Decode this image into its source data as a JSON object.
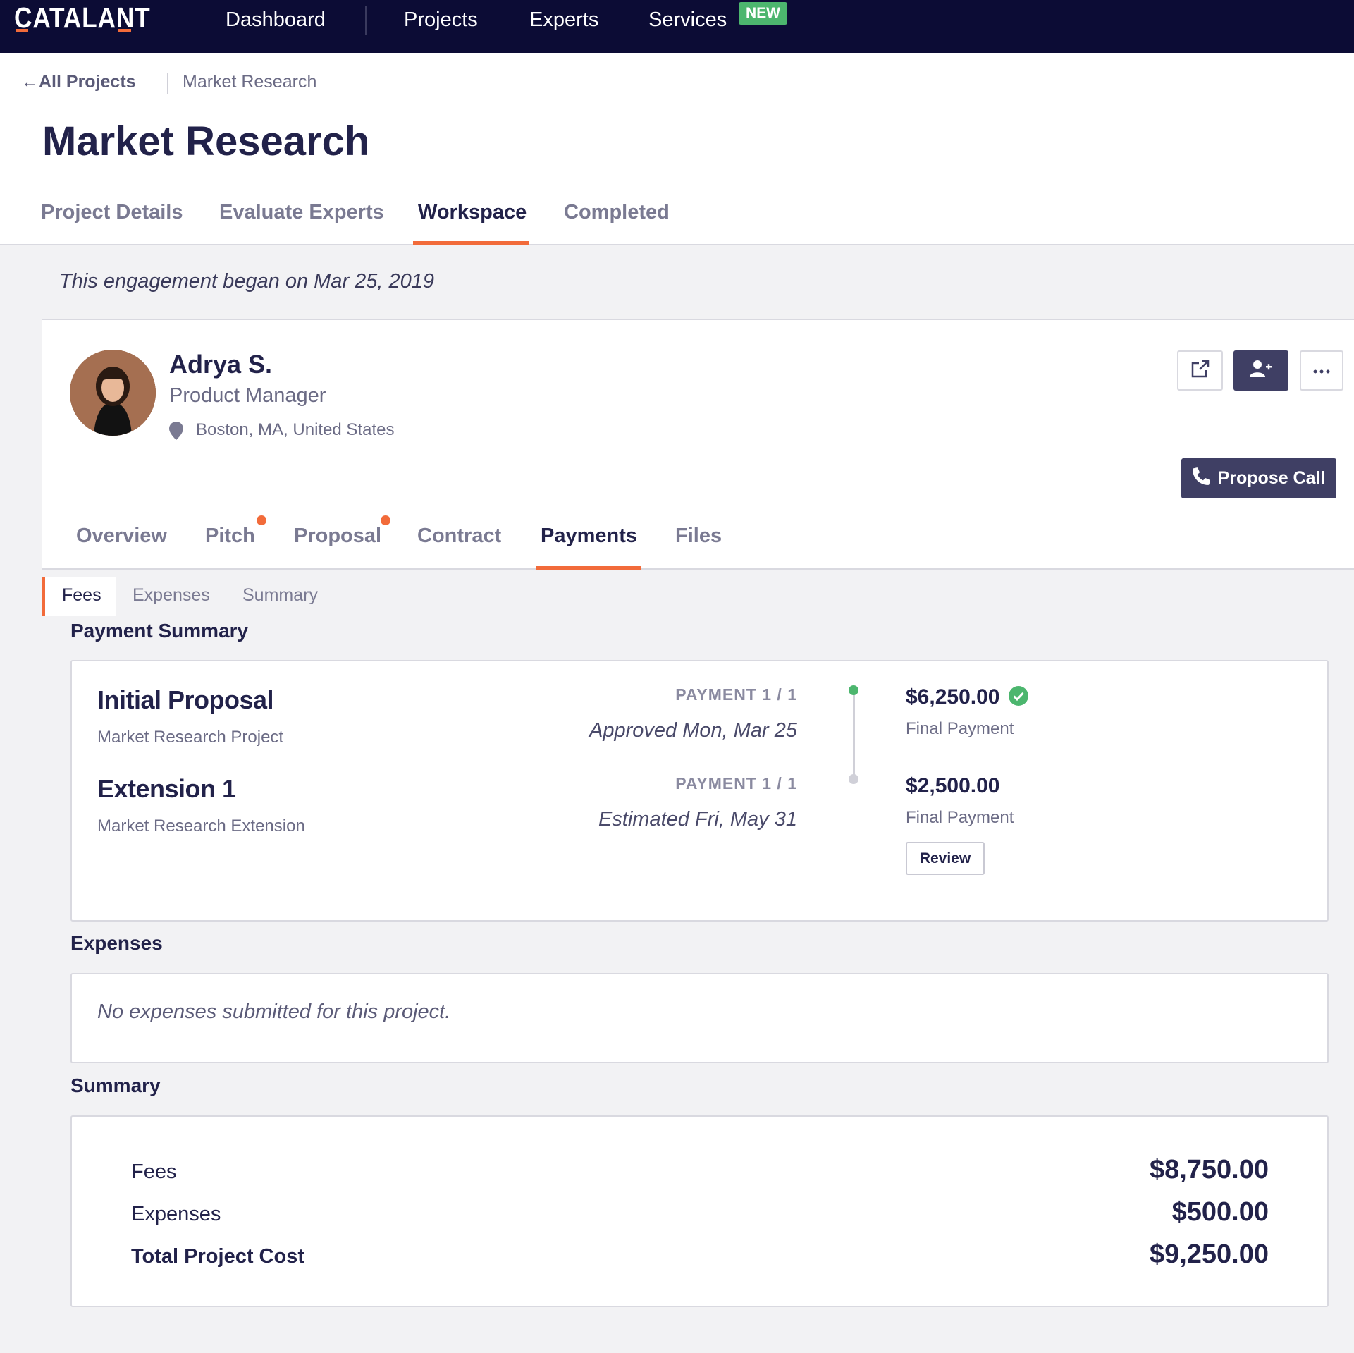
{
  "brand": {
    "logo_text": "CATALANT",
    "accent": "#f26b3a",
    "nav_bg": "#0c0c35"
  },
  "topnav": {
    "items": [
      {
        "label": "Dashboard"
      },
      {
        "label": "Projects"
      },
      {
        "label": "Experts"
      },
      {
        "label": "Services"
      }
    ],
    "new_badge": "NEW"
  },
  "breadcrumb": {
    "back_label": "All Projects",
    "back_icon": "arrow-left-icon",
    "current": "Market Research"
  },
  "page": {
    "title": "Market Research"
  },
  "tabs": [
    {
      "label": "Project Details"
    },
    {
      "label": "Evaluate Experts"
    },
    {
      "label": "Workspace",
      "active": true
    },
    {
      "label": "Completed"
    }
  ],
  "engagement_note": "This engagement began on Mar 25, 2019",
  "expert": {
    "name": "Adrya S.",
    "role": "Product Manager",
    "location": "Boston, MA, United States",
    "actions": {
      "open_icon": "external-link-icon",
      "add_icon": "user-plus-icon",
      "more_icon": "ellipsis-icon"
    },
    "propose_call_label": "Propose Call"
  },
  "expert_tabs": [
    {
      "label": "Overview"
    },
    {
      "label": "Pitch",
      "notification": true
    },
    {
      "label": "Proposal",
      "notification": true
    },
    {
      "label": "Contract"
    },
    {
      "label": "Payments",
      "active": true
    },
    {
      "label": "Files"
    }
  ],
  "payment_tabs": [
    {
      "label": "Fees",
      "active": true
    },
    {
      "label": "Expenses"
    },
    {
      "label": "Summary"
    }
  ],
  "payment_summary": {
    "title": "Payment Summary",
    "items": [
      {
        "title": "Initial Proposal",
        "subtitle": "Market Research Project",
        "payment_label": "PAYMENT 1 / 1",
        "date": "Approved Mon, Mar 25",
        "amount": "$6,250.00",
        "status_icon": "check-circle-icon",
        "type": "Final Payment"
      },
      {
        "title": "Extension 1",
        "subtitle": "Market Research Extension",
        "payment_label": "PAYMENT 1 / 1",
        "date": "Estimated Fri, May 31",
        "amount": "$2,500.00",
        "type": "Final Payment",
        "action_label": "Review"
      }
    ]
  },
  "expenses": {
    "title": "Expenses",
    "empty_message": "No expenses submitted for this project."
  },
  "summary": {
    "title": "Summary",
    "rows": [
      {
        "label": "Fees",
        "value": "$8,750.00"
      },
      {
        "label": "Expenses",
        "value": "$500.00"
      },
      {
        "label": "Total Project Cost",
        "value": "$9,250.00"
      }
    ]
  }
}
